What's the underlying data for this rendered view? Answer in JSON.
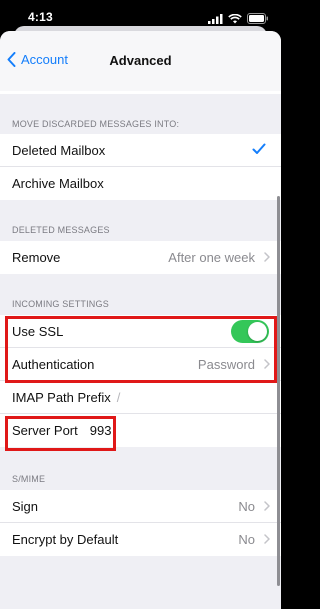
{
  "status_bar": {
    "time": "4:13",
    "icons": [
      "signal-icon",
      "wifi-icon",
      "battery-icon"
    ]
  },
  "nav": {
    "back_label": "Account",
    "title": "Advanced"
  },
  "sections": {
    "discarded": {
      "header": "MOVE DISCARDED MESSAGES INTO:",
      "rows": [
        {
          "label": "Deleted Mailbox",
          "selected": true
        },
        {
          "label": "Archive Mailbox",
          "selected": false
        }
      ]
    },
    "deleted": {
      "header": "DELETED MESSAGES",
      "rows": [
        {
          "label": "Remove",
          "value": "After one week"
        }
      ]
    },
    "incoming": {
      "header": "INCOMING SETTINGS",
      "use_ssl": {
        "label": "Use SSL",
        "enabled": true
      },
      "authentication": {
        "label": "Authentication",
        "value": "Password"
      },
      "imap_prefix": {
        "label": "IMAP Path Prefix",
        "value": "/"
      },
      "server_port": {
        "label": "Server Port",
        "value": "993"
      }
    },
    "smime": {
      "header": "S/MIME",
      "rows": [
        {
          "label": "Sign",
          "value": "No"
        },
        {
          "label": "Encrypt by Default",
          "value": "No"
        }
      ]
    }
  },
  "colors": {
    "accent": "#147efb",
    "toggle_on": "#34c759",
    "highlight": "#e01818",
    "background": "#efeff4"
  }
}
